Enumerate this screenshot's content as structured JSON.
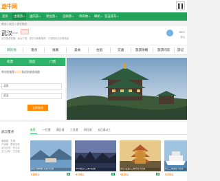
{
  "brand": {
    "logo": "途牛网"
  },
  "nav": {
    "items": [
      {
        "label": "首页"
      },
      {
        "label": "出境游",
        "caret": "▾"
      },
      {
        "label": "国内游",
        "caret": "▾"
      },
      {
        "label": "周边游",
        "caret": "▾"
      },
      {
        "label": "自助游",
        "caret": "▾"
      },
      {
        "label": "目的地",
        "caret": "▾"
      },
      {
        "label": "邮轮",
        "caret": "▾"
      },
      {
        "label": "签证租车",
        "caret": "▾"
      }
    ]
  },
  "breadcrumb": "首页 > 武汉 > 武汉旅游",
  "city": {
    "name": "武汉",
    "pinyin": "Wuhan",
    "subtitle": "武汉旅游攻略，景点介绍，游记与美食推荐，江城特色文化等信息",
    "weather": {
      "temp": "25°C",
      "desc": "多云"
    }
  },
  "categories": [
    {
      "label": "目的地"
    },
    {
      "label": "景点"
    },
    {
      "label": "线路"
    },
    {
      "label": "美食"
    },
    {
      "label": "住宿"
    },
    {
      "label": "交通"
    },
    {
      "label": "旅游攻略"
    },
    {
      "label": "旅游问答"
    },
    {
      "label": "游记"
    }
  ],
  "search": {
    "tabs": [
      {
        "label": "机票"
      },
      {
        "label": "酒店"
      },
      {
        "label": "门票"
      }
    ],
    "prompt_prefix": "将向您推荐",
    "prompt_count": "24万+",
    "prompt_suffix": "条优质旅游线路",
    "from_value": "北京",
    "to_value": "武汉",
    "button": "立即查询"
  },
  "lower": {
    "left_title": "武汉景点",
    "left_rows": [
      "黄鹤楼 · 东湖",
      "户部巷 · 楚河汉街",
      "武汉大学 · 归元寺",
      "长江大桥 · 江汉路"
    ],
    "filters": [
      {
        "label": "推荐"
      },
      {
        "label": "一日游"
      },
      {
        "label": "两日游"
      },
      {
        "label": "三日游"
      },
      {
        "label": "四日游"
      },
      {
        "label": "五日游以上"
      }
    ],
    "cards": [
      {
        "caption": "武汉+黄鹤楼+东湖 2日游",
        "price": "¥168",
        "qi": "起",
        "tag": "促"
      },
      {
        "caption": "2020武汉+三峡 5日游",
        "price": "¥198",
        "qi": "起",
        "tag": "促"
      },
      {
        "caption": "武汉+宜昌+三峡大坝 4日游",
        "price": "¥158",
        "qi": "起",
        "tag": "促"
      },
      {
        "caption": "长江三峡游轮 6日游",
        "price": "¥258",
        "qi": "起",
        "tag": "促"
      }
    ]
  },
  "colors": {
    "nav": "#23a35a",
    "accent": "#ff8a00",
    "price": "#ff6a00"
  }
}
